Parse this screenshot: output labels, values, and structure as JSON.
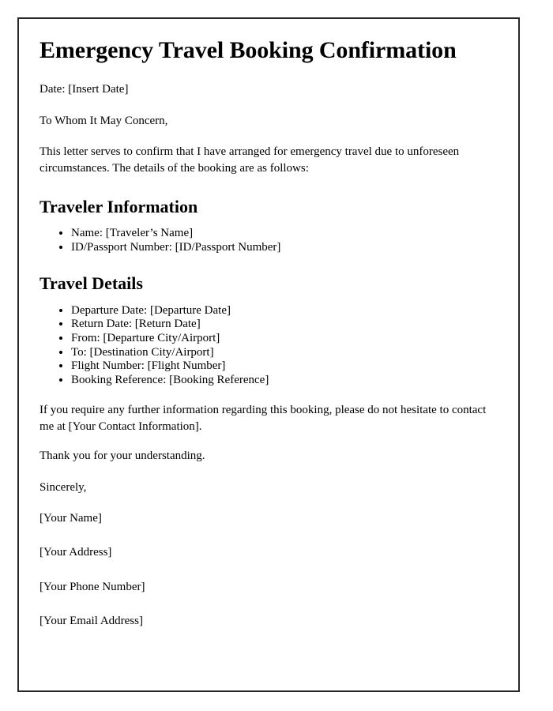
{
  "document": {
    "title": "Emergency Travel Booking Confirmation",
    "date_line": "Date: [Insert Date]",
    "salutation": "To Whom It May Concern,",
    "intro_paragraph": "This letter serves to confirm that I have arranged for emergency travel due to unforeseen circumstances. The details of the booking are as follows:",
    "sections": [
      {
        "heading": "Traveler Information",
        "items": [
          "Name: [Traveler’s Name]",
          "ID/Passport Number: [ID/Passport Number]"
        ]
      },
      {
        "heading": "Travel Details",
        "items": [
          "Departure Date: [Departure Date]",
          "Return Date: [Return Date]",
          "From: [Departure City/Airport]",
          "To: [Destination City/Airport]",
          "Flight Number: [Flight Number]",
          "Booking Reference: [Booking Reference]"
        ]
      }
    ],
    "contact_paragraph": "If you require any further information regarding this booking, please do not hesitate to contact me at [Your Contact Information].",
    "thanks_paragraph": "Thank you for your understanding.",
    "closing": "Sincerely,",
    "signature_lines": [
      "[Your Name]",
      "[Your Address]",
      "[Your Phone Number]",
      "[Your Email Address]"
    ]
  },
  "style": {
    "border_color": "#26262b",
    "text_color": "#000000",
    "background_color": "#ffffff"
  }
}
